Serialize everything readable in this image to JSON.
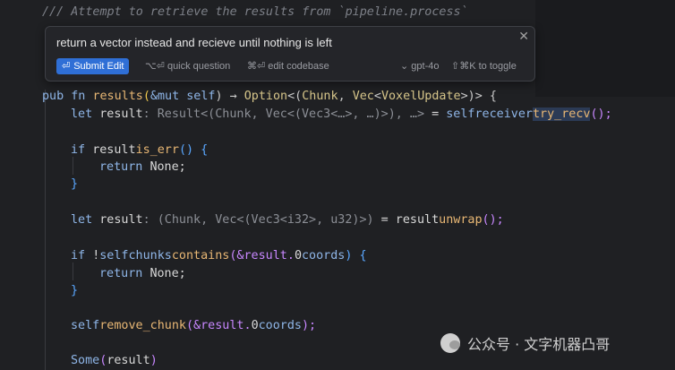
{
  "comment": "/// Attempt to retrieve the results from `pipeline.process`",
  "popup": {
    "input_text": "return a vector instead and recieve until nothing is left",
    "close_glyph": "✕",
    "submit_label": "Submit Edit",
    "submit_icon": "enter-key-icon",
    "quick_question": "⌥⏎ quick question",
    "edit_codebase": "⌘⏎ edit codebase",
    "model_label": "gpt-4o",
    "toggle_label": "⇧⌘K to toggle"
  },
  "code": {
    "l1": {
      "kw1": "pub fn ",
      "name": "results",
      "p1": "(",
      "kw2": "&mut self",
      ">": ") → ",
      "ret1": "Option",
      "lt": "<(",
      "t1": "Chunk",
      ",": ", ",
      "t2": "Vec",
      "lt2": "<",
      "t3": "VoxelUpdate",
      "end": ">)> {"
    },
    "l2": {
      "kw": "let ",
      "var": "result",
      "hint": ": Result<(Chunk, Vec<(Vec3<…>, …)>), …>",
      "eq": " = ",
      "self": "self",
      ".": ".",
      "field": "receiver",
      ".2": ".",
      "fn": "try_recv",
      "call": "();"
    },
    "l3": {
      "kw": "if ",
      "var": "result",
      ".": ".",
      "fn": "is_err",
      "call": "() {"
    },
    "l4": {
      "kw": "return ",
      "val": "None;"
    },
    "l5": {
      "brace": "}"
    },
    "l6": {
      "kw": "let ",
      "var": "result",
      "hint": ": (Chunk, Vec<(Vec3<i32>, u32)>)",
      "eq": " = ",
      "v2": "result",
      ".": ".",
      "fn": "unwrap",
      "call": "();"
    },
    "l7": {
      "kw": "if ",
      "bang": "!",
      "self": "self",
      ".": ".",
      "field": "chunks",
      ".2": ".",
      "fn": "contains",
      "p": "(&result.",
      "n": "0",
      ".3": ".",
      "field2": "coords",
      "end": ") {"
    },
    "l8": {
      "kw": "return ",
      "val": "None;"
    },
    "l9": {
      "brace": "}"
    },
    "l10": {
      "self": "self",
      ".": ".",
      "fn": "remove_chunk",
      "p": "(&result.",
      "n": "0",
      ".2": ".",
      "field": "coords",
      "end": ");"
    },
    "l11": {
      "kw": "Some",
      "p": "(",
      "v": "result",
      ")": ")"
    }
  },
  "watermark": {
    "text": "公众号 · 文字机器凸哥",
    "icon": "wechat-icon"
  }
}
